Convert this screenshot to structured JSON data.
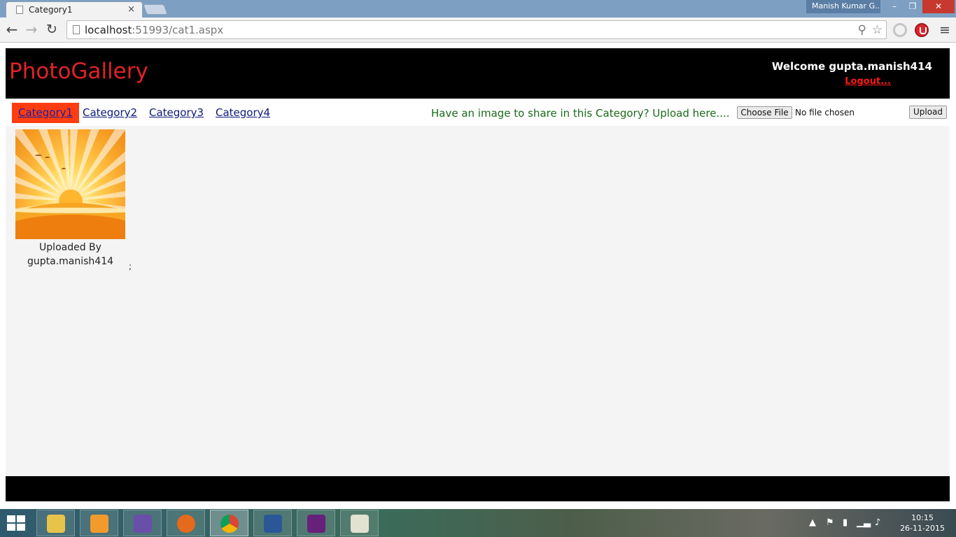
{
  "browser": {
    "tab_title": "Category1",
    "tab_close": "×",
    "profile_name": "Manish Kumar G...",
    "win_minimize": "–",
    "win_restore": "❐",
    "win_close": "✕",
    "url_host": "localhost",
    "url_path": ":51993/cat1.aspx",
    "back_glyph": "←",
    "forward_glyph": "→",
    "reload_glyph": "↻",
    "zoom_glyph": "⚲",
    "star_glyph": "☆",
    "menu_glyph": "≡"
  },
  "site": {
    "brand": "PhotoGallery",
    "welcome": "Welcome gupta.manish414",
    "logout": "Logout...",
    "categories": [
      "Category1",
      "Category2",
      "Category3",
      "Category4"
    ],
    "active_category": "Category1",
    "upload_prompt": "Have an image to share in this Category? Upload here....",
    "choose_file": "Choose File",
    "file_status": "No file chosen",
    "upload_button": "Upload",
    "photos": [
      {
        "caption_line1": "Uploaded By",
        "caption_line2": "gupta.manish414"
      }
    ],
    "stray_semicolon": ";"
  },
  "taskbar": {
    "clock_time": "10:15",
    "clock_date": "26-11-2015",
    "apps": [
      "file-explorer",
      "media-player",
      "visual-studio-old",
      "firefox",
      "chrome",
      "word",
      "visual-studio",
      "paint"
    ]
  },
  "colors": {
    "brand": "#e02228",
    "active_tab_bg": "#ff3d10",
    "link": "#0a1a7a",
    "prompt": "#1a6a1a",
    "logout": "#ff1a1a"
  }
}
